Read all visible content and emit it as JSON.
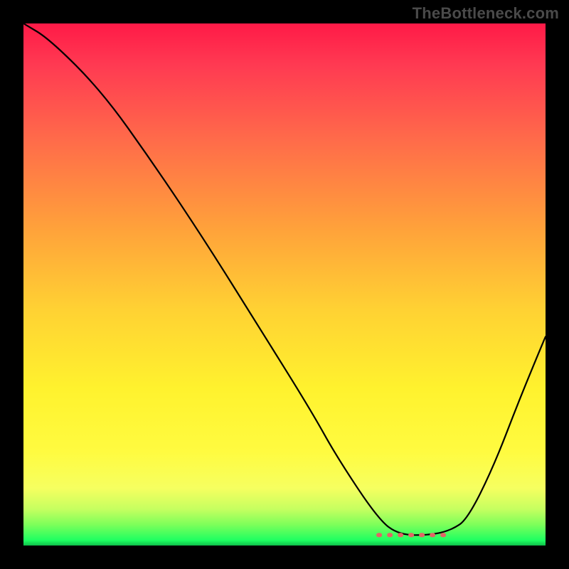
{
  "attribution": "TheBottleneck.com",
  "chart_data": {
    "type": "line",
    "title": "",
    "xlabel": "",
    "ylabel": "",
    "xlim": [
      0,
      100
    ],
    "ylim": [
      0,
      100
    ],
    "series": [
      {
        "name": "bottleneck-curve",
        "color": "#000000",
        "x": [
          0,
          5,
          15,
          25,
          35,
          45,
          55,
          60,
          68,
          72,
          78,
          82,
          85,
          90,
          95,
          100
        ],
        "y": [
          100,
          97,
          87,
          73,
          58,
          42,
          26,
          17,
          5,
          2,
          2,
          3,
          5,
          15,
          28,
          40
        ]
      }
    ],
    "annotations": [
      {
        "name": "optimal-range-marker",
        "type": "dotted-segment",
        "color": "#e06666",
        "x_from": 68,
        "x_to": 82,
        "y": 2
      }
    ],
    "background_gradient": {
      "direction": "vertical",
      "stops": [
        {
          "pos": 0,
          "color": "#ff1a47"
        },
        {
          "pos": 40,
          "color": "#ffa43a"
        },
        {
          "pos": 70,
          "color": "#fff22e"
        },
        {
          "pos": 95,
          "color": "#7dff5a"
        },
        {
          "pos": 100,
          "color": "#0fbf4a"
        }
      ]
    }
  }
}
